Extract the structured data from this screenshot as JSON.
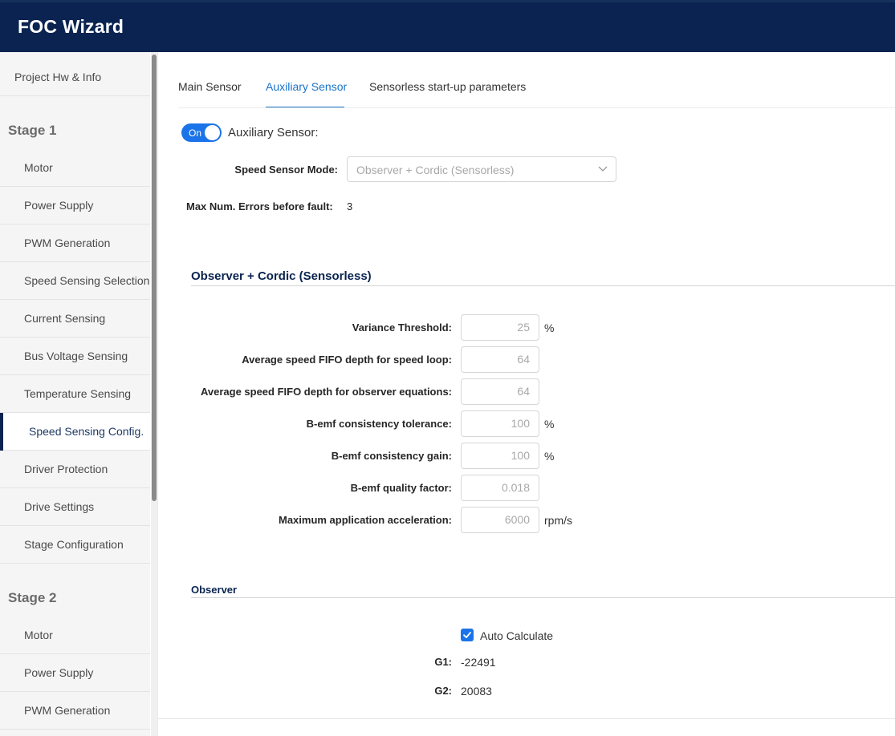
{
  "app": {
    "title": "FOC Wizard"
  },
  "sidebar": {
    "top_item": "Project Hw & Info",
    "stage1": {
      "label": "Stage 1",
      "items": [
        "Motor",
        "Power Supply",
        "PWM Generation",
        "Speed Sensing Selection",
        "Current Sensing",
        "Bus Voltage Sensing",
        "Temperature Sensing",
        "Speed Sensing Config.",
        "Driver Protection",
        "Drive Settings",
        "Stage Configuration"
      ],
      "active": "Speed Sensing Config."
    },
    "stage2": {
      "label": "Stage 2",
      "items": [
        "Motor",
        "Power Supply",
        "PWM Generation"
      ]
    }
  },
  "tabs": {
    "main": "Main Sensor",
    "auxiliary": "Auxiliary Sensor",
    "sensorless": "Sensorless start-up parameters",
    "active": "Auxiliary Sensor"
  },
  "aux_sensor": {
    "toggle_state": "On",
    "label": "Auxiliary Sensor:",
    "speed_mode_label": "Speed Sensor Mode:",
    "speed_mode_value": "Observer + Cordic (Sensorless)",
    "max_errors_label": "Max Num. Errors before fault:",
    "max_errors_value": "3"
  },
  "observer_cordic": {
    "title": "Observer + Cordic (Sensorless)",
    "fields": [
      {
        "label": "Variance Threshold:",
        "value": "25",
        "unit": "%"
      },
      {
        "label": "Average speed FIFO depth for speed loop:",
        "value": "64",
        "unit": ""
      },
      {
        "label": "Average speed FIFO depth for observer equations:",
        "value": "64",
        "unit": ""
      },
      {
        "label": "B-emf consistency tolerance:",
        "value": "100",
        "unit": "%"
      },
      {
        "label": "B-emf consistency gain:",
        "value": "100",
        "unit": "%"
      },
      {
        "label": "B-emf quality factor:",
        "value": "0.018",
        "unit": ""
      },
      {
        "label": "Maximum application acceleration:",
        "value": "6000",
        "unit": "rpm/s"
      }
    ]
  },
  "observer": {
    "title": "Observer",
    "auto_calculate_label": "Auto Calculate",
    "auto_calculate_checked": true,
    "g1_label": "G1:",
    "g1_value": "-22491",
    "g2_label": "G2:",
    "g2_value": "20083"
  },
  "colors": {
    "header": "#0a2350",
    "accent": "#1a73e8",
    "tab_active": "#1a73c9"
  }
}
